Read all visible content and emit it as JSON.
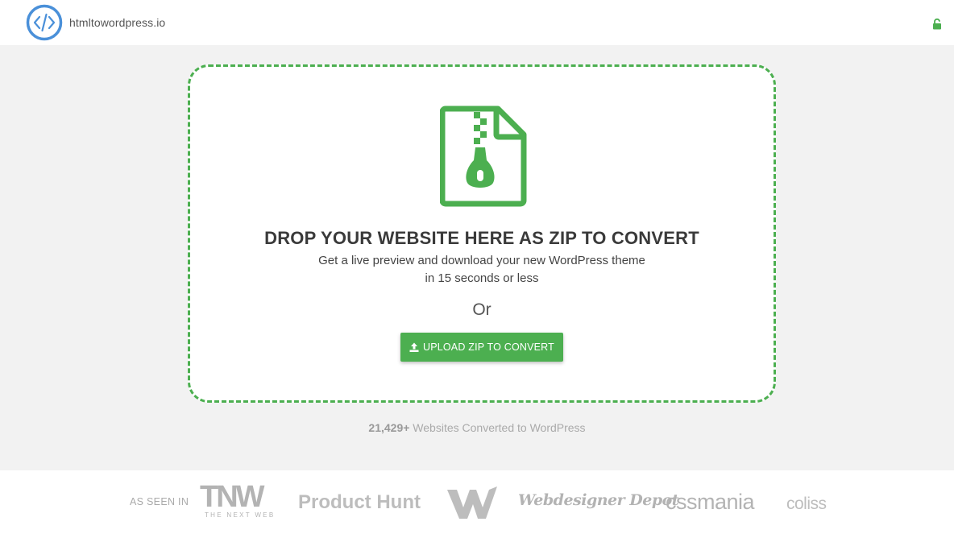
{
  "header": {
    "brand": "htmltowordpress.io",
    "logo_icon": "code-brackets-icon",
    "lock_icon": "unlocked-padlock-icon"
  },
  "dropzone": {
    "icon": "zip-file-icon",
    "title": "DROP YOUR WEBSITE HERE AS ZIP TO CONVERT",
    "subtitle_line1": "Get a live preview and download your new WordPress theme",
    "subtitle_line2": "in 15 seconds or less",
    "or_text": "Or",
    "upload_button_label": "UPLOAD ZIP TO CONVERT",
    "upload_icon": "upload-icon"
  },
  "stats": {
    "count": "21,429+",
    "text": " Websites Converted to WordPress"
  },
  "footer": {
    "seen_in_label": "AS SEEN IN",
    "press": {
      "tnw_big": "TNW",
      "tnw_small": "THE NEXT WEB",
      "product_hunt": "Product Hunt",
      "webdesigner_depot": "Webdesigner Depot",
      "cssmania": "cssmania",
      "coliss": "coliss"
    }
  },
  "colors": {
    "accent_green": "#4caf50",
    "logo_blue": "#4a90d9",
    "main_bg": "#f2f2f2",
    "muted_text": "#aaaaaa"
  }
}
